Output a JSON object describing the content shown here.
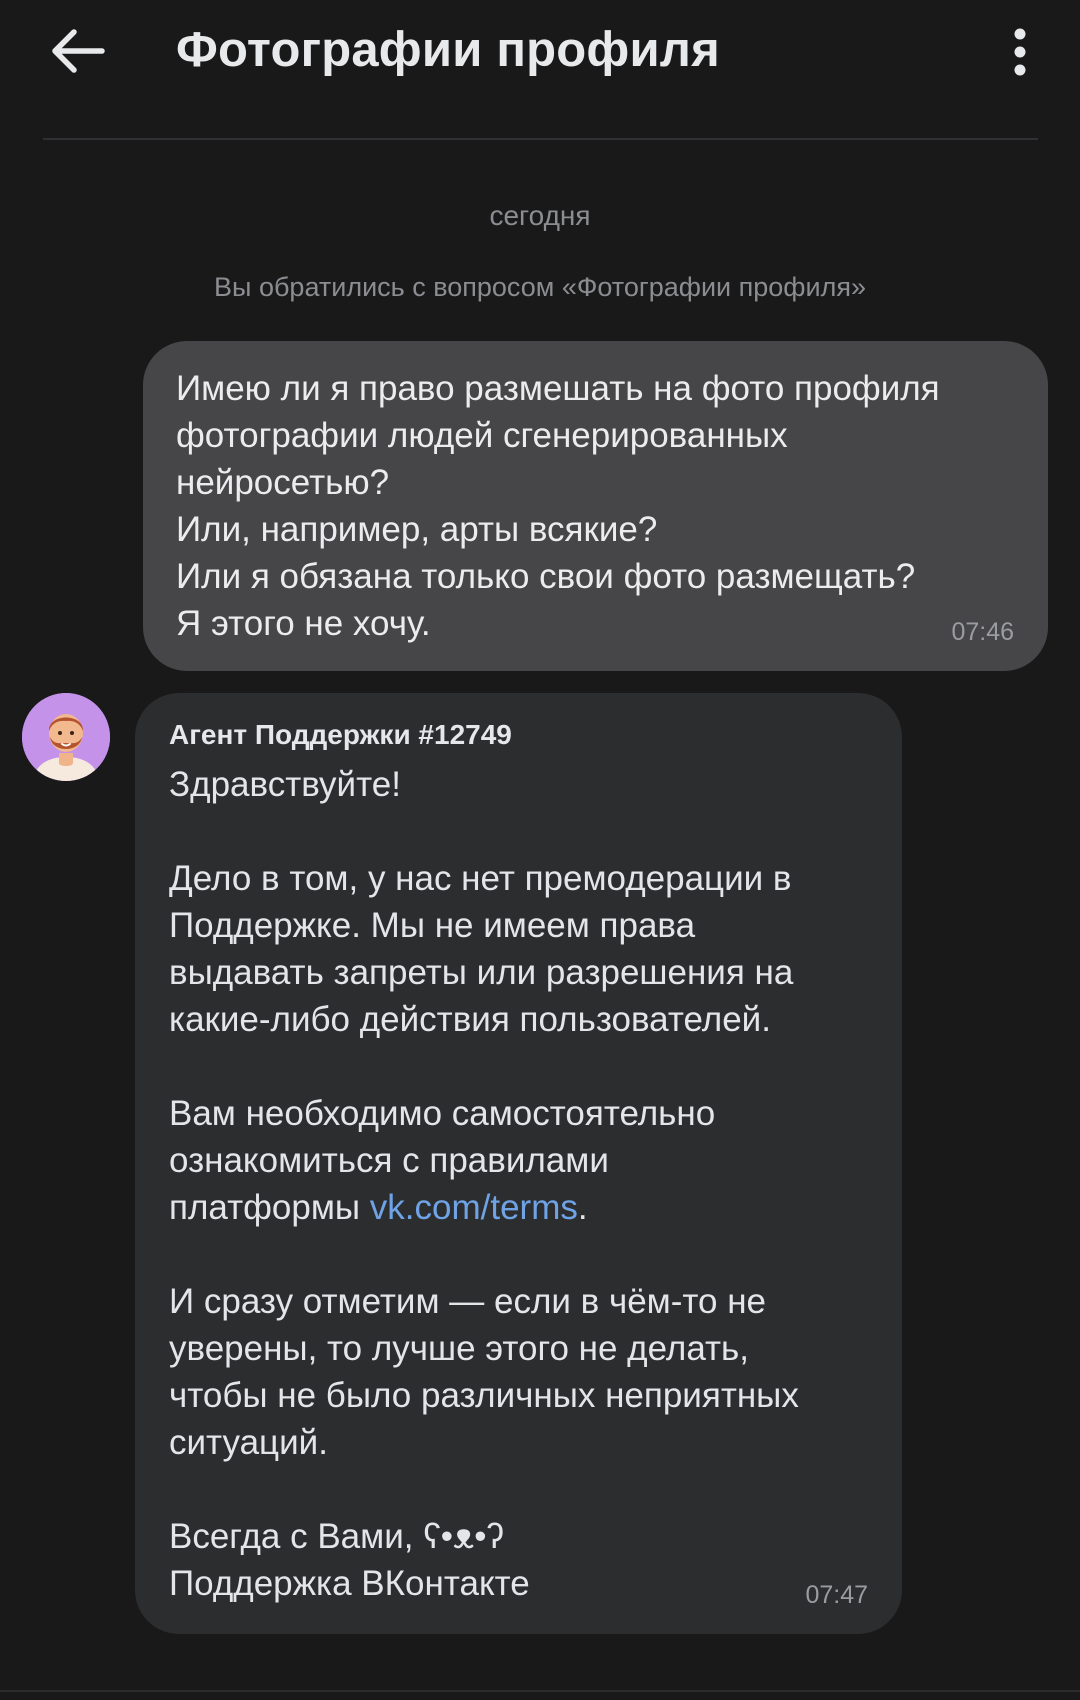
{
  "header": {
    "title": "Фотографии профиля",
    "back_icon": "arrow-left-icon",
    "menu_icon": "more-vertical-icon"
  },
  "date_separator": "сегодня",
  "system_note": "Вы обратились с вопросом «Фотографии профиля»",
  "messages": {
    "outgoing": {
      "text": "Имею ли я право размешать на фото профиля\nфотографии людей сгенерированных\nнейросетью?\nИли, например, арты всякие?\nИли я обязана только свои фото размещать?\nЯ этого не хочу.",
      "time": "07:46"
    },
    "incoming": {
      "sender": "Агент Поддержки #12749",
      "p1": "Здравствуйте!",
      "p2": "Дело в том, у нас нет премодерации в\nПоддержке. Мы не имеем права\nвыдавать запреты или разрешения на\nкакие-либо действия пользователей.",
      "p3_before": "Вам необходимо самостоятельно\nознакомиться с правилами\nплатформы ",
      "p3_link": "vk.com/terms",
      "p3_after": ".",
      "p4": "И сразу отметим — если в чём-то не\nуверены, то лучше этого не делать,\nчтобы не было различных неприятных\nситуаций.",
      "p5": "Всегда с Вами, ʕ•ᴥ•ʔ\nПоддержка ВКонтакте",
      "time": "07:47"
    }
  },
  "colors": {
    "background": "#19191a",
    "outgoing_bubble": "#464649",
    "incoming_bubble": "#2c2d2f",
    "link": "#6fa3e6",
    "avatar_bg": "#c592ea"
  }
}
